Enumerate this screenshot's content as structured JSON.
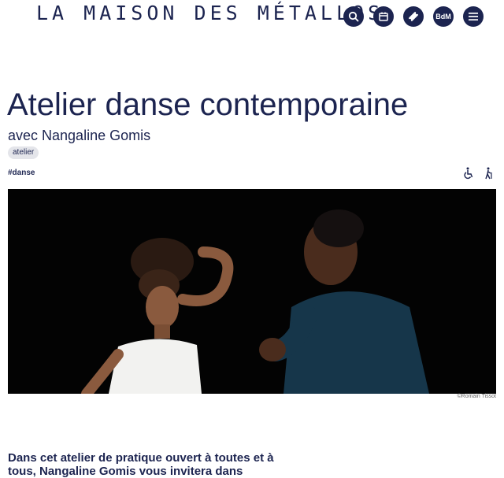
{
  "site": {
    "logo_text": "LA MAISON DES MÉTALLOS"
  },
  "header": {
    "buttons": [
      {
        "icon": "search-icon"
      },
      {
        "icon": "calendar-icon"
      },
      {
        "icon": "ticket-icon"
      },
      {
        "icon": "bdm-icon",
        "label": "BdM"
      },
      {
        "icon": "menu-icon"
      }
    ]
  },
  "event": {
    "title": "Atelier danse contemporaine",
    "subtitle": "avec Nangaline Gomis",
    "tag": "atelier",
    "hashtag": "#danse",
    "accessibility_icons": [
      "wheelchair-icon",
      "walking-aid-icon"
    ],
    "photo_credit": "©Romain Tissot",
    "intro": "Dans cet atelier de pratique ouvert à toutes et à tous, Nangaline Gomis vous invitera dans"
  },
  "colors": {
    "brand": "#1c2450",
    "tag_bg": "#e4e5ea",
    "photo_bg": "#030303"
  }
}
